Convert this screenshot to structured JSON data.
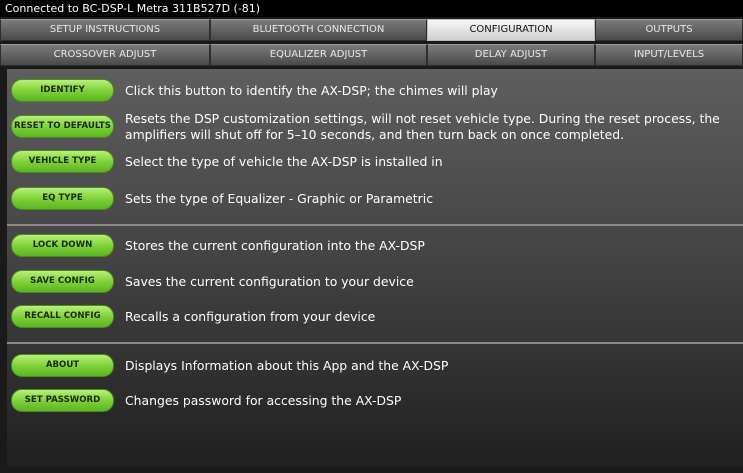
{
  "status_bar": {
    "text": "Connected to BC-DSP-L Metra 311B527D (-81)"
  },
  "tabs_row1": [
    "SETUP INSTRUCTIONS",
    "BLUETOOTH CONNECTION",
    "CONFIGURATION",
    "OUTPUTS"
  ],
  "tabs_row2": [
    "CROSSOVER ADJUST",
    "EQUALIZER ADJUST",
    "DELAY ADJUST",
    "INPUT/LEVELS"
  ],
  "active_tab": "CONFIGURATION",
  "actions": {
    "identify": {
      "label": "IDENTIFY",
      "desc": "Click this button to identify the AX-DSP; the chimes will play"
    },
    "reset": {
      "label": "RESET TO DEFAULTS",
      "desc_line1": "Resets the DSP customization settings, will not reset vehicle type. During the reset process, the",
      "desc_line2": "amplifiers will shut off for 5–10 seconds, and then turn back on once completed."
    },
    "vehicle_type": {
      "label": "VEHICLE TYPE",
      "desc": "Select the type of vehicle the AX-DSP is installed in"
    },
    "eq_type": {
      "label": "EQ TYPE",
      "desc": "Sets the type of Equalizer - Graphic or Parametric"
    },
    "lock_down": {
      "label": "LOCK DOWN",
      "desc": "Stores the current configuration into the AX-DSP"
    },
    "save_config": {
      "label": "SAVE CONFIG",
      "desc": "Saves the current configuration to your device"
    },
    "recall_config": {
      "label": "RECALL CONFIG",
      "desc": "Recalls a configuration from your device"
    },
    "about": {
      "label": "ABOUT",
      "desc": "Displays Information about this App and the AX-DSP"
    },
    "set_password": {
      "label": "SET PASSWORD",
      "desc": "Changes password for accessing the AX-DSP"
    }
  },
  "colors": {
    "button_green": "#7fd23a",
    "active_tab": "#e8e8e8",
    "background": "#454545"
  }
}
